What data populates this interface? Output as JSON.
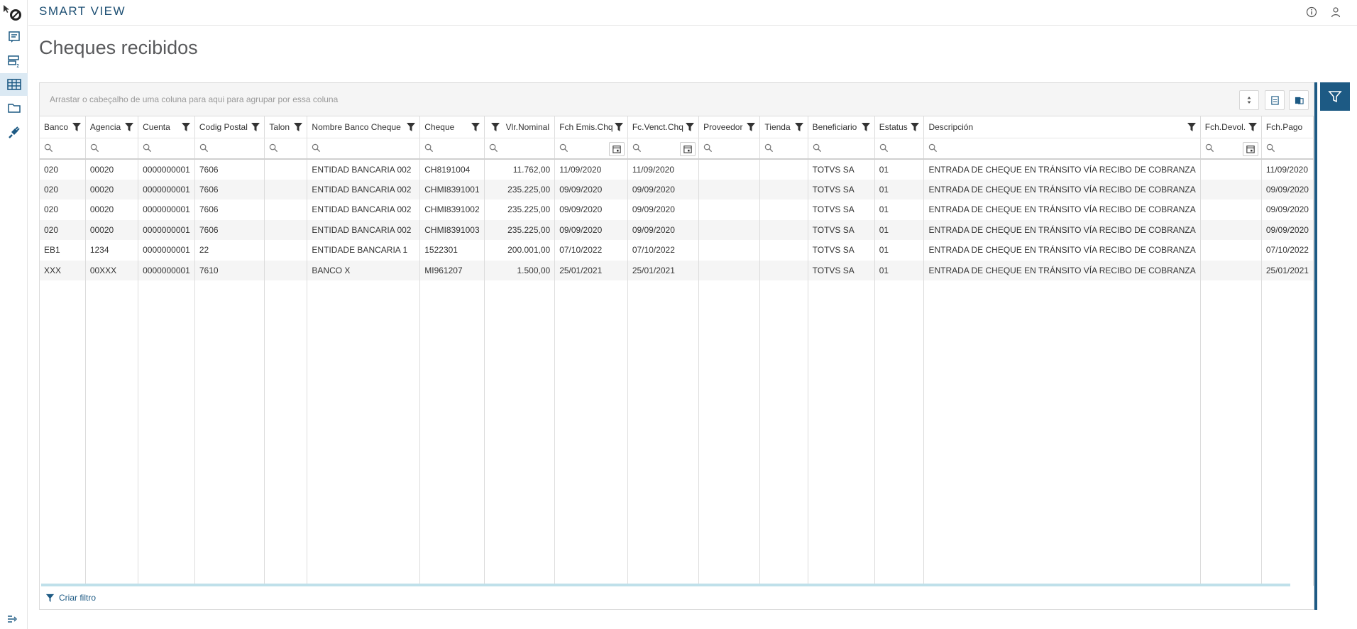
{
  "app": {
    "title": "SMART VIEW"
  },
  "page": {
    "title": "Cheques recibidos"
  },
  "sidebar": {
    "items": [
      {
        "icon": "document-list-icon"
      },
      {
        "icon": "summary-list-icon"
      },
      {
        "icon": "table-icon",
        "active": true
      },
      {
        "icon": "folder-icon"
      },
      {
        "icon": "plug-icon"
      }
    ]
  },
  "grid": {
    "group_panel_text": "Arrastar o cabeçalho de uma coluna para aqui para agrupar por essa coluna",
    "columns": [
      {
        "label": "Banco"
      },
      {
        "label": "Agencia"
      },
      {
        "label": "Cuenta"
      },
      {
        "label": "Codig Postal"
      },
      {
        "label": "Talon"
      },
      {
        "label": "Nombre Banco Cheque"
      },
      {
        "label": "Cheque"
      },
      {
        "label": "Vlr.Nominal"
      },
      {
        "label": "Fch Emis.Chq"
      },
      {
        "label": "Fc.Venct.Chq"
      },
      {
        "label": "Proveedor"
      },
      {
        "label": "Tienda"
      },
      {
        "label": "Beneficiario"
      },
      {
        "label": "Estatus"
      },
      {
        "label": "Descripción"
      },
      {
        "label": "Fch.Devol."
      },
      {
        "label": "Fch.Pago"
      }
    ],
    "rows": [
      [
        "020",
        "00020",
        "0000000001",
        "7606",
        "",
        "ENTIDAD BANCARIA 002",
        "CH8191004",
        "11.762,00",
        "11/09/2020",
        "11/09/2020",
        "",
        "",
        "TOTVS SA",
        "01",
        "ENTRADA DE CHEQUE EN TRÁNSITO VÍA RECIBO DE COBRANZA",
        "",
        "11/09/2020"
      ],
      [
        "020",
        "00020",
        "0000000001",
        "7606",
        "",
        "ENTIDAD BANCARIA 002",
        "CHMI8391001",
        "235.225,00",
        "09/09/2020",
        "09/09/2020",
        "",
        "",
        "TOTVS SA",
        "01",
        "ENTRADA DE CHEQUE EN TRÁNSITO VÍA RECIBO DE COBRANZA",
        "",
        "09/09/2020"
      ],
      [
        "020",
        "00020",
        "0000000001",
        "7606",
        "",
        "ENTIDAD BANCARIA 002",
        "CHMI8391002",
        "235.225,00",
        "09/09/2020",
        "09/09/2020",
        "",
        "",
        "TOTVS SA",
        "01",
        "ENTRADA DE CHEQUE EN TRÁNSITO VÍA RECIBO DE COBRANZA",
        "",
        "09/09/2020"
      ],
      [
        "020",
        "00020",
        "0000000001",
        "7606",
        "",
        "ENTIDAD BANCARIA 002",
        "CHMI8391003",
        "235.225,00",
        "09/09/2020",
        "09/09/2020",
        "",
        "",
        "TOTVS SA",
        "01",
        "ENTRADA DE CHEQUE EN TRÁNSITO VÍA RECIBO DE COBRANZA",
        "",
        "09/09/2020"
      ],
      [
        "EB1",
        "1234",
        "0000000001",
        "22",
        "",
        "ENTIDADE BANCARIA 1",
        "1522301",
        "200.001,00",
        "07/10/2022",
        "07/10/2022",
        "",
        "",
        "TOTVS SA",
        "01",
        "ENTRADA DE CHEQUE EN TRÁNSITO VÍA RECIBO DE COBRANZA",
        "",
        "07/10/2022"
      ],
      [
        "XXX",
        "00XXX",
        "0000000001",
        "7610",
        "",
        "BANCO X",
        "MI961207",
        "1.500,00",
        "25/01/2021",
        "25/01/2021",
        "",
        "",
        "TOTVS SA",
        "01",
        "ENTRADA DE CHEQUE EN TRÁNSITO VÍA RECIBO DE COBRANZA",
        "",
        "25/01/2021"
      ]
    ],
    "footer_label": "Criar filtro"
  },
  "colors": {
    "accent": "#1d5a84",
    "title": "#1d4f73"
  }
}
